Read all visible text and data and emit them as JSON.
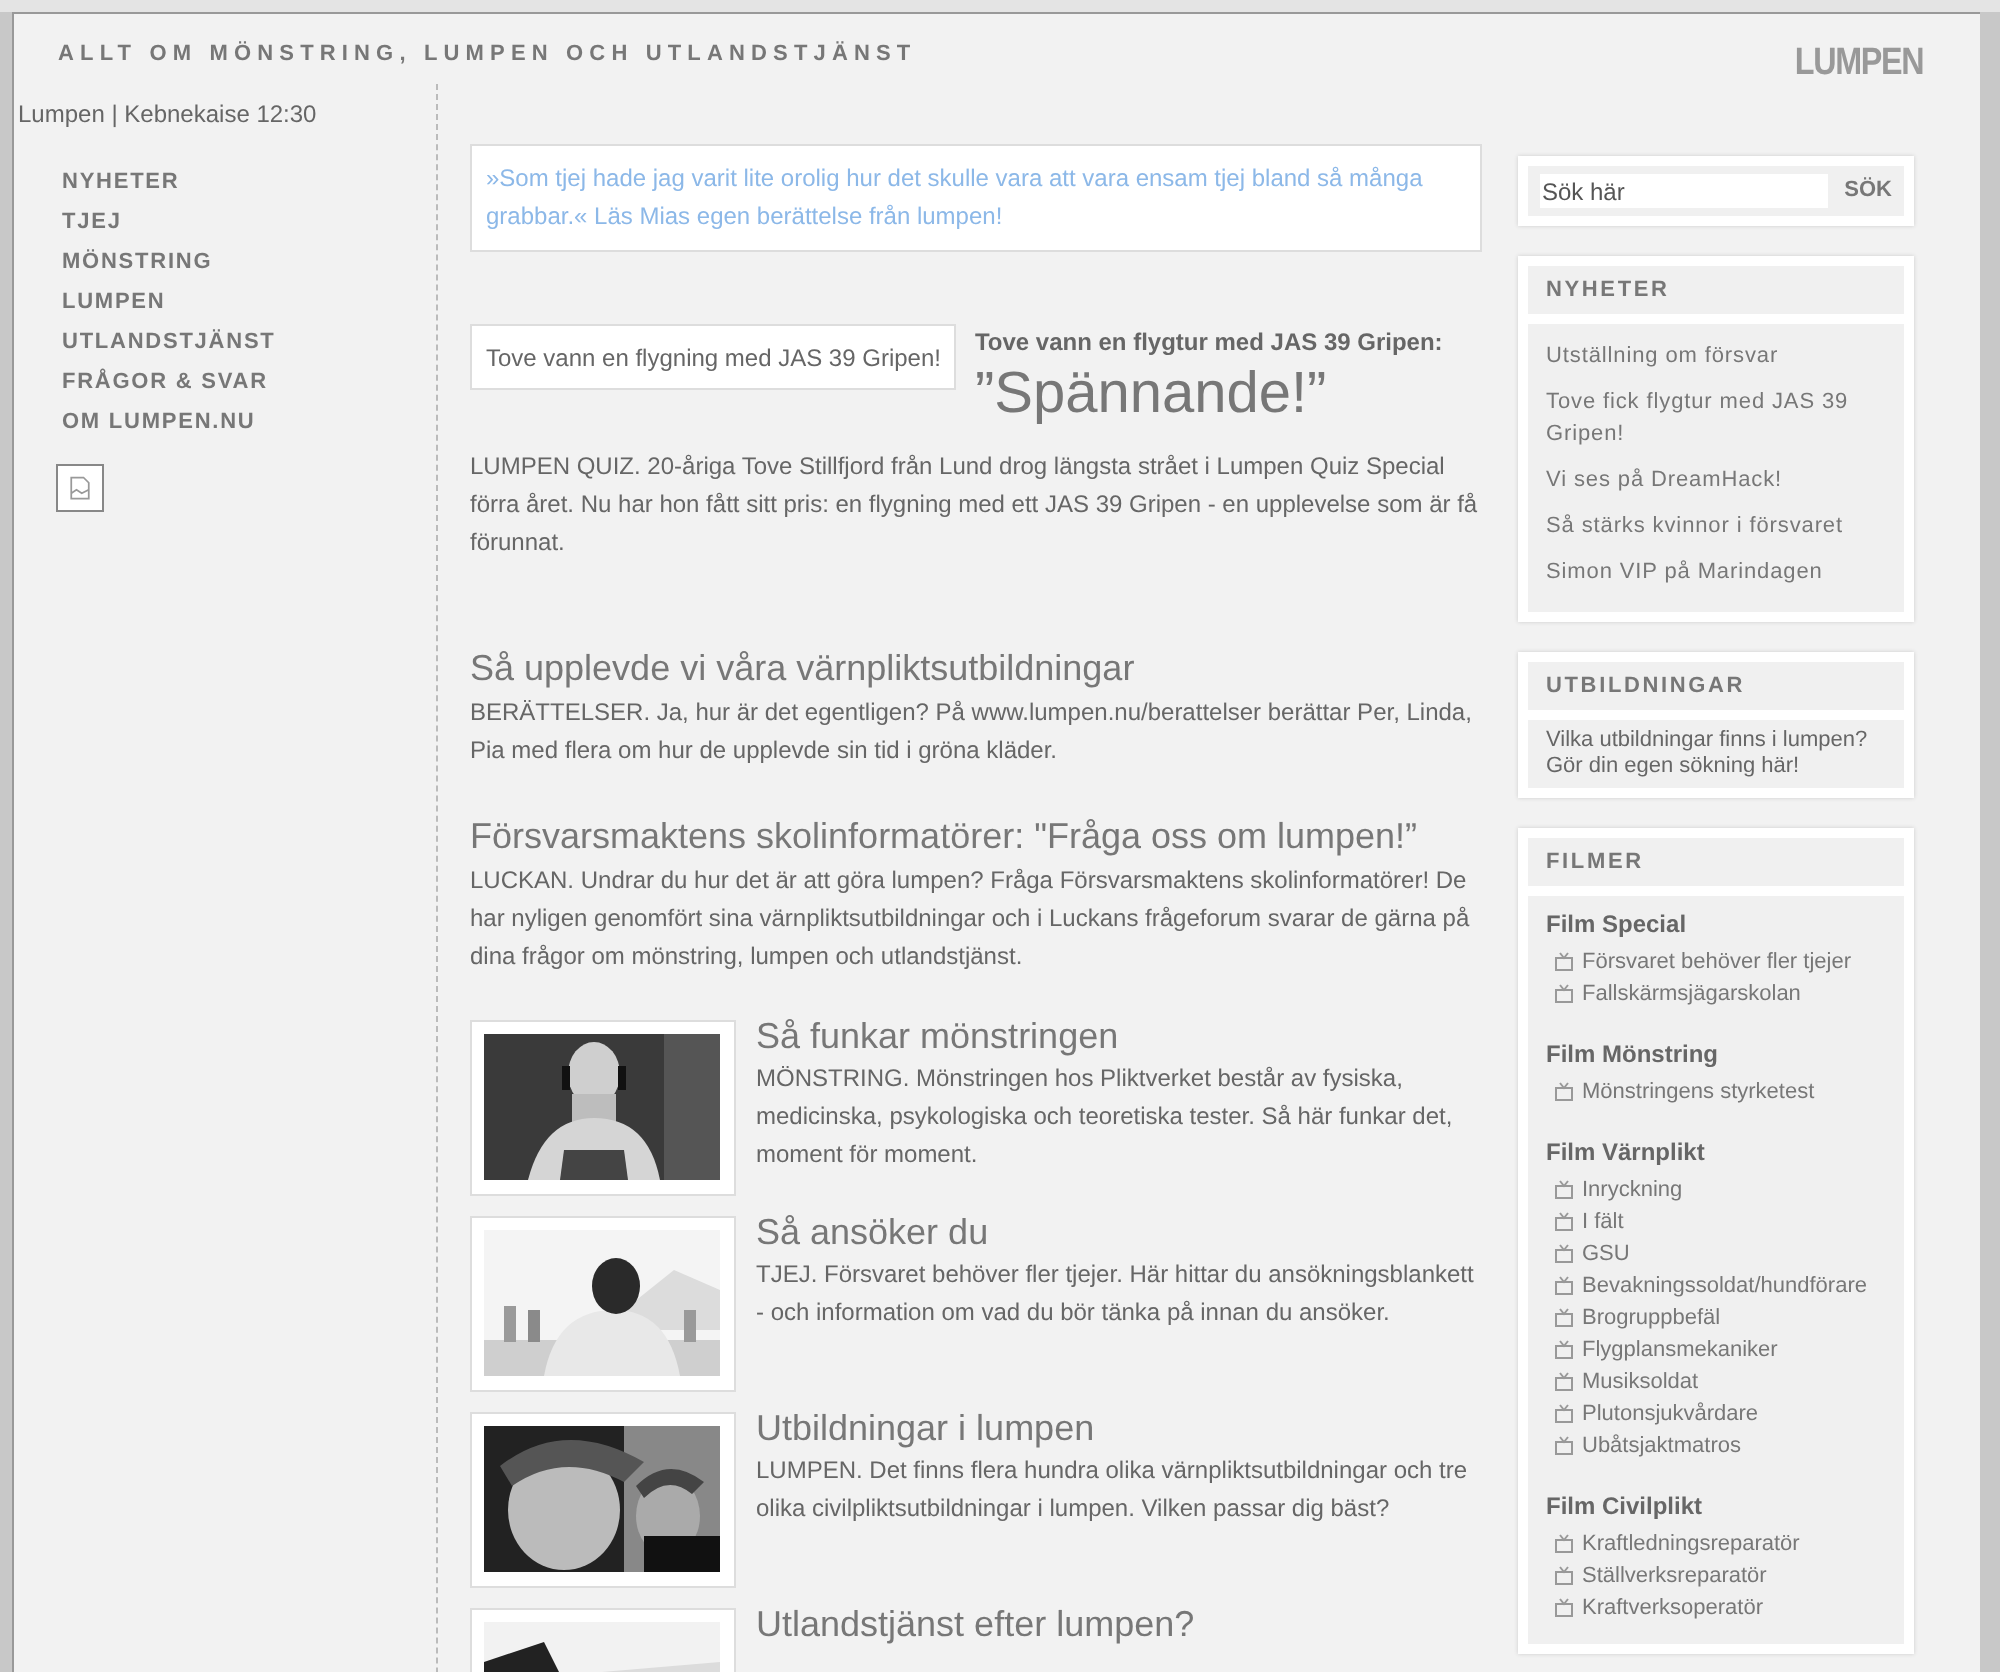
{
  "header": {
    "tagline": "ALLT OM MÖNSTRING, LUMPEN OCH UTLANDSTJÄNST",
    "logo": "LUMPEN"
  },
  "breadcrumb": "Lumpen | Kebnekaise 12:30",
  "nav": [
    "NYHETER",
    "TJEJ",
    "MÖNSTRING",
    "LUMPEN",
    "UTLANDSTJÄNST",
    "FRÅGOR & SVAR",
    "OM LUMPEN.NU"
  ],
  "quote": "»Som tjej hade jag varit lite orolig hur det skulle vara att vara ensam tjej bland så många grabbar.« Läs Mias egen berättelse från lumpen!",
  "featured": {
    "image_caption": "Tove vann en flygning med JAS 39 Gripen!",
    "kicker": "Tove vann en flygtur med JAS 39 Gripen:",
    "headline": "”Spännande!”",
    "body": "LUMPEN QUIZ. 20-åriga Tove Stillfjord från Lund drog längsta strået i Lumpen Quiz Special förra året. Nu har hon fått sitt pris: en flygning med ett JAS 39 Gripen - en upplevelse som är få förunnat."
  },
  "stories": [
    {
      "title": "Så upplevde vi våra värnpliktsutbildningar",
      "body": "BERÄTTELSER. Ja, hur är det egentligen? På www.lumpen.nu/berattelser berättar Per, Linda, Pia med flera om hur de upplevde sin tid i gröna kläder."
    },
    {
      "title": "Försvarsmaktens skolinformatörer: \"Fråga oss om lumpen!”",
      "body": "LUCKAN. Undrar du hur det är att göra lumpen? Fråga Försvarsmaktens skolinformatörer! De har nyligen genomfört sina värnpliktsutbildningar och i Luckans frågeforum svarar de gärna på dina frågor om mönstring, lumpen och utlandstjänst."
    }
  ],
  "articles": [
    {
      "title": "Så funkar mönstringen",
      "body": "MÖNSTRING. Mönstringen hos Pliktverket består av fysiska, medicinska, psykologiska och teoretiska tester. Så här funkar det, moment för moment."
    },
    {
      "title": "Så ansöker du",
      "body": "TJEJ. Försvaret  behöver fler tjejer. Här hittar du ansökningsblankett - och information om vad du bör tänka på innan du ansöker."
    },
    {
      "title": "Utbildningar i lumpen",
      "body": "LUMPEN. Det finns flera hundra olika värnpliktsutbildningar och tre olika civilpliktsutbildningar i lumpen. Vilken passar dig bäst?"
    },
    {
      "title": "Utlandstjänst efter lumpen?"
    }
  ],
  "search": {
    "placeholder": "Sök här",
    "button": "SÖK"
  },
  "news": {
    "title": "NYHETER",
    "items": [
      "Utställning om försvar",
      "Tove fick flygtur med JAS 39 Gripen!",
      "Vi ses på DreamHack!",
      "Så stärks kvinnor i försvaret",
      "Simon VIP på Marindagen"
    ]
  },
  "education": {
    "title": "UTBILDNINGAR",
    "lines": [
      "Vilka utbildningar finns i lumpen?",
      "Gör din egen sökning här!"
    ]
  },
  "films": {
    "title": "FILMER",
    "groups": [
      {
        "title": "Film Special",
        "items": [
          "Försvaret behöver fler tjejer",
          "Fallskärmsjägarskolan"
        ]
      },
      {
        "title": "Film Mönstring",
        "items": [
          "Mönstringens styrketest"
        ]
      },
      {
        "title": "Film Värnplikt",
        "items": [
          "Inryckning",
          "I fält",
          "GSU",
          "Bevakningssoldat/hundförare",
          "Brogruppbefäl",
          "Flygplansmekaniker",
          "Musiksoldat",
          "Plutonsjukvårdare",
          "Ubåtsjaktmatros"
        ]
      },
      {
        "title": "Film Civilplikt",
        "items": [
          "Kraftledningsreparatör",
          "Ställverksreparatör",
          "Kraftverksoperatör"
        ]
      }
    ]
  }
}
